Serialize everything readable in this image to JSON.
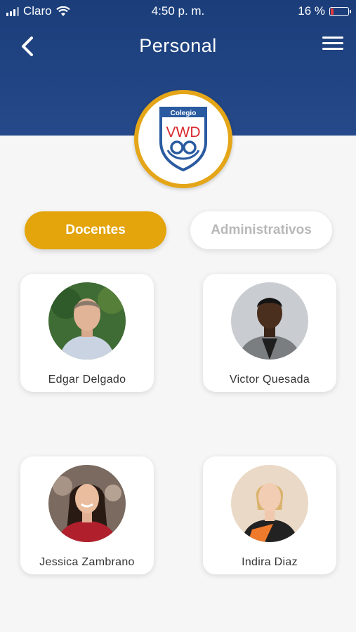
{
  "status_bar": {
    "carrier": "Claro",
    "time": "4:50 p. m.",
    "battery": "16 %",
    "battery_level": 0.16
  },
  "header": {
    "title": "Personal",
    "back_icon": "chevron-left-icon",
    "menu_icon": "hamburger-menu-icon"
  },
  "logo": {
    "top_text": "Colegio",
    "main_text": "VWD",
    "colors": {
      "ring": "#e4a618",
      "shield": "#2a5aa0",
      "letters": "#d9272e"
    }
  },
  "tabs": [
    {
      "label": "Docentes",
      "active": true
    },
    {
      "label": "Administrativos",
      "active": false
    }
  ],
  "staff": [
    {
      "name": "Edgar Delgado"
    },
    {
      "name": "Victor Quesada"
    },
    {
      "name": "Jessica Zambrano"
    },
    {
      "name": "Indira Diaz"
    }
  ],
  "colors": {
    "header": "#1f437f",
    "accent": "#e4a40b",
    "background": "#f6f6f6"
  }
}
